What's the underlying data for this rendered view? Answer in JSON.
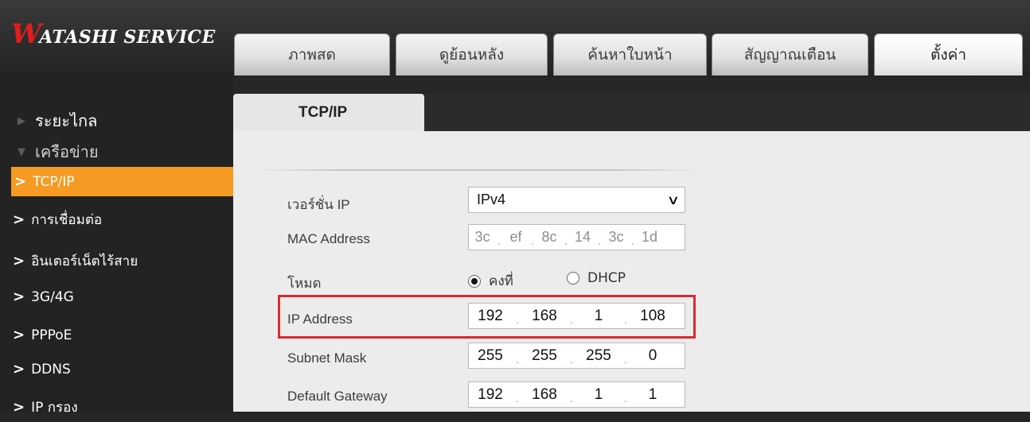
{
  "logo": {
    "mark": "W",
    "text": "ATASHI SERVICE"
  },
  "tabs": [
    {
      "label": "ภาพสด"
    },
    {
      "label": "ดูย้อนหลัง"
    },
    {
      "label": "ค้นหาใบหน้า"
    },
    {
      "label": "สัญญาณเตือน"
    },
    {
      "label": "ตั้งค่า"
    }
  ],
  "sidebar": {
    "sections": [
      {
        "label": "ระยะไกล"
      },
      {
        "label": "เครือข่าย"
      }
    ],
    "items": [
      {
        "label": "TCP/IP"
      },
      {
        "label": "การเชื่อมต่อ"
      },
      {
        "label": "อินเตอร์เน็ตไร้สาย"
      },
      {
        "label": "3G/4G"
      },
      {
        "label": "PPPoE"
      },
      {
        "label": "DDNS"
      },
      {
        "label": "IP กรอง"
      }
    ]
  },
  "page": {
    "title": "TCP/IP"
  },
  "form": {
    "ip_version": {
      "label": "เวอร์ชั่น IP",
      "value": "IPv4"
    },
    "mac": {
      "label": "MAC Address",
      "octets": [
        "3c",
        "ef",
        "8c",
        "14",
        "3c",
        "1d"
      ]
    },
    "mode": {
      "label": "โหมด",
      "options": [
        "คงที่",
        "DHCP"
      ],
      "selected": "คงที่"
    },
    "ip": {
      "label": "IP Address",
      "octets": [
        "192",
        "168",
        "1",
        "108"
      ]
    },
    "subnet": {
      "label": "Subnet Mask",
      "octets": [
        "255",
        "255",
        "255",
        "0"
      ]
    },
    "gateway": {
      "label": "Default Gateway",
      "octets": [
        "192",
        "168",
        "1",
        "1"
      ]
    }
  },
  "colors": {
    "accent": "#f59a23",
    "highlight": "#d92a31",
    "logo_mark": "#e11d1d"
  }
}
